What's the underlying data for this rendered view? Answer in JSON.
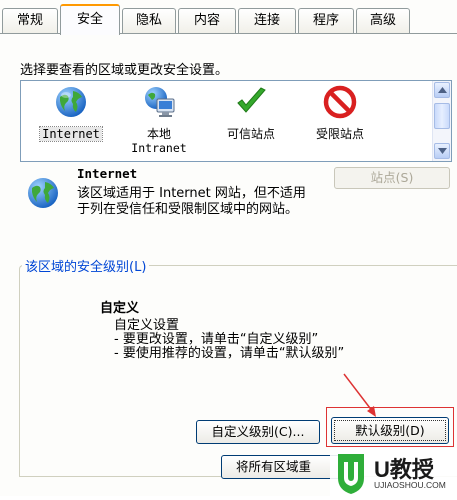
{
  "tabs": [
    {
      "label": "常规",
      "active": false
    },
    {
      "label": "安全",
      "active": true
    },
    {
      "label": "隐私",
      "active": false
    },
    {
      "label": "内容",
      "active": false
    },
    {
      "label": "连接",
      "active": false
    },
    {
      "label": "程序",
      "active": false
    },
    {
      "label": "高级",
      "active": false
    }
  ],
  "intro": "选择要查看的区域或更改安全设置。",
  "zones": [
    {
      "label1": "Internet",
      "label2": "",
      "icon": "globe-icon",
      "selected": true
    },
    {
      "label1": "本地",
      "label2": "Intranet",
      "icon": "local-intranet-icon",
      "selected": false
    },
    {
      "label1": "可信站点",
      "label2": "",
      "icon": "checkmark-icon",
      "selected": false
    },
    {
      "label1": "受限站点",
      "label2": "",
      "icon": "restricted-icon",
      "selected": false
    }
  ],
  "zone_info": {
    "name": "Internet",
    "description": "该区域适用于 Internet 网站，但不适用于列在受信任和受限制区域中的网站。",
    "sites_button": "站点(S)"
  },
  "security_level": {
    "legend": "该区域的安全级别(L)",
    "title": "自定义",
    "lines": [
      "自定义设置",
      "- 要更改设置，请单击“自定义级别”",
      "- 要使用推荐的设置，请单击“默认级别”"
    ],
    "custom_button": "自定义级别(C)...",
    "default_button": "默认级别(D)",
    "reset_all_button": "将所有区域重"
  },
  "watermark": {
    "brand": "U教授",
    "url": "UJIAOSHOU.COM"
  },
  "colors": {
    "accent_tab": "#ff9900",
    "annotation": "#dd3333",
    "link_blue": "#0046d5"
  }
}
